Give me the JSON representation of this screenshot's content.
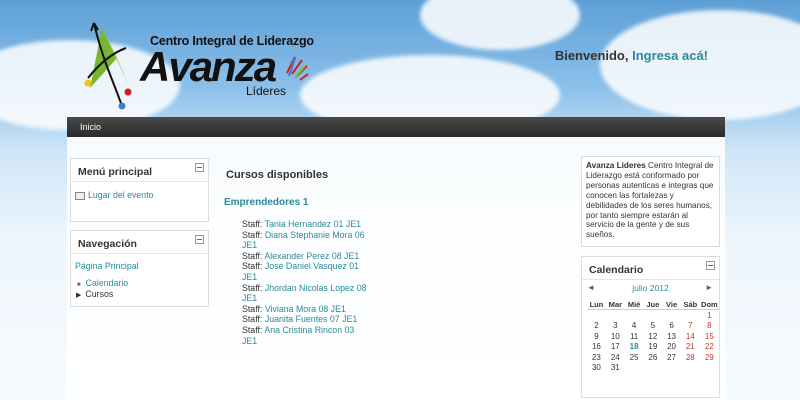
{
  "header": {
    "logo_title": "Centro Integral de Liderazgo",
    "logo_brand": "Avanza",
    "logo_sub": "Líderes",
    "welcome_text": "Bienvenido,",
    "welcome_link": "Ingresa acá!"
  },
  "navbar": {
    "home": "Inicio"
  },
  "menu_principal": {
    "title": "Menú principal",
    "items": [
      "Lugar del evento"
    ]
  },
  "navegacion": {
    "title": "Navegación",
    "home": "Página Principal",
    "items": [
      "Calendario",
      "Cursos"
    ]
  },
  "main": {
    "title": "Cursos disponibles",
    "course": "Emprendedores 1",
    "staff_label": "Staff:",
    "staff": [
      "Tania Hernandez 01 JE1",
      "Diana Stephanie Mora 06 JE1",
      "Alexander Perez 08 JE1",
      "Jose Daniel Vasquez 01 JE1",
      "Jhordan Nicolas Lopez 08 JE1",
      "Viviana Mora 08 JE1",
      "Juanita Fuentes 07 JE1",
      "Ana Cristina Rincon 03 JE1"
    ]
  },
  "about": {
    "bold": "Avanza Lideres",
    "text": "Centro Integral de Liderazgo está conformado por personas autenticas e integras que conocen las fortalezas y debilidades de los seres humanos, por tanto siempre estarán al servicio de la gente y de sus sueños."
  },
  "calendar": {
    "title": "Calendario",
    "month": "julio 2012",
    "prev": "◄",
    "next": "►",
    "days": [
      "Lun",
      "Mar",
      "Mié",
      "Jue",
      "Vie",
      "Sáb",
      "Dom"
    ],
    "weeks": [
      [
        "",
        "",
        "",
        "",
        "",
        "",
        "1"
      ],
      [
        "2",
        "3",
        "4",
        "5",
        "6",
        "7",
        "8"
      ],
      [
        "9",
        "10",
        "11",
        "12",
        "13",
        "14",
        "15"
      ],
      [
        "16",
        "17",
        "18",
        "19",
        "20",
        "21",
        "22"
      ],
      [
        "23",
        "24",
        "25",
        "26",
        "27",
        "28",
        "29"
      ],
      [
        "30",
        "31",
        "",
        "",
        "",
        "",
        ""
      ]
    ],
    "today": "18"
  },
  "colors": {
    "accent": "#2a8a9a",
    "weekend": "#c0392b",
    "navbar": "#333333"
  }
}
